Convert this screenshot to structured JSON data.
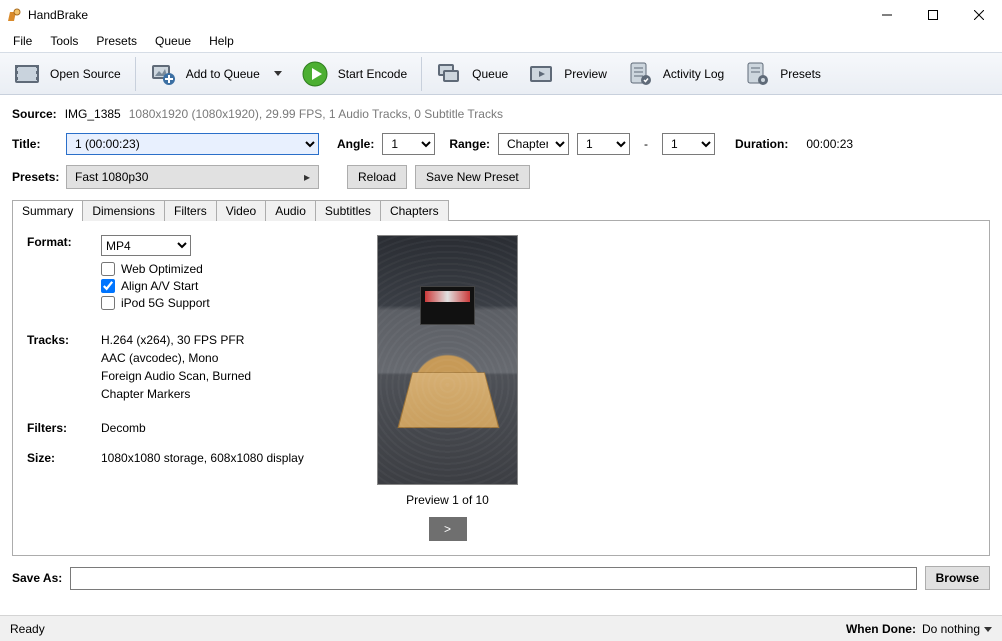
{
  "window": {
    "title": "HandBrake"
  },
  "menu": [
    "File",
    "Tools",
    "Presets",
    "Queue",
    "Help"
  ],
  "toolbar": {
    "open_source": "Open Source",
    "add_to_queue": "Add to Queue",
    "start_encode": "Start Encode",
    "queue": "Queue",
    "preview": "Preview",
    "activity_log": "Activity Log",
    "presets": "Presets"
  },
  "source": {
    "label": "Source:",
    "name": "IMG_1385",
    "meta": "1080x1920 (1080x1920), 29.99 FPS, 1 Audio Tracks, 0 Subtitle Tracks"
  },
  "title_row": {
    "title_label": "Title:",
    "title_value": "1 (00:00:23)",
    "angle_label": "Angle:",
    "angle_value": "1",
    "range_label": "Range:",
    "range_mode": "Chapters",
    "range_from": "1",
    "range_dash": "-",
    "range_to": "1",
    "duration_label": "Duration:",
    "duration_value": "00:00:23"
  },
  "presets_row": {
    "label": "Presets:",
    "current": "Fast 1080p30",
    "reload": "Reload",
    "save_new": "Save New Preset"
  },
  "tabs": [
    "Summary",
    "Dimensions",
    "Filters",
    "Video",
    "Audio",
    "Subtitles",
    "Chapters"
  ],
  "summary": {
    "format_label": "Format:",
    "format_value": "MP4",
    "web_optimized": "Web Optimized",
    "align_av": "Align A/V Start",
    "ipod": "iPod 5G Support",
    "align_av_checked": true,
    "tracks_label": "Tracks:",
    "tracks": [
      "H.264 (x264), 30 FPS PFR",
      "AAC (avcodec), Mono",
      "Foreign Audio Scan, Burned",
      "Chapter Markers"
    ],
    "filters_label": "Filters:",
    "filters_value": "Decomb",
    "size_label": "Size:",
    "size_value": "1080x1080 storage, 608x1080 display",
    "preview_caption": "Preview 1 of 10",
    "preview_next": ">"
  },
  "save": {
    "label": "Save As:",
    "value": "",
    "browse": "Browse"
  },
  "status": {
    "ready": "Ready",
    "when_done_label": "When Done:",
    "when_done_value": "Do nothing"
  }
}
